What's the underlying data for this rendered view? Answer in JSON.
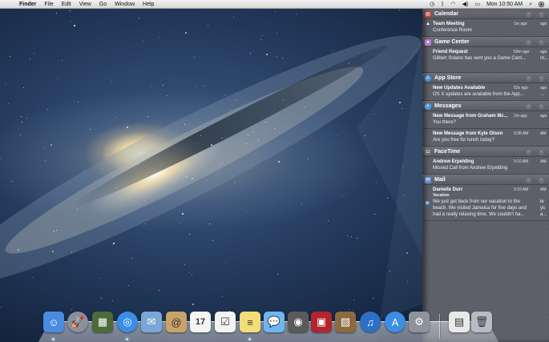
{
  "menubar": {
    "apple_glyph": "",
    "app_name": "Finder",
    "menus": [
      "File",
      "Edit",
      "View",
      "Go",
      "Window",
      "Help"
    ],
    "clock": "Mon 10:50 AM",
    "status_icons": [
      "time-machine-icon",
      "bluetooth-icon",
      "wifi-icon",
      "volume-icon",
      "battery-icon",
      "spotlight-icon"
    ]
  },
  "notification_center": {
    "sections": [
      {
        "app": "Calendar",
        "icon": "calendar-icon",
        "icon_color": "#c33b3b",
        "items": [
          {
            "title": "Team Meeting",
            "time": "1m ago",
            "time_dup": "ago",
            "body": "Conference Room"
          }
        ]
      },
      {
        "app": "Game Center",
        "icon": "game-center-icon",
        "icon_color": "#b47cc8",
        "items": [
          {
            "title": "Friend Request",
            "time": "59m ago",
            "time_dup": "ago",
            "body": "Gilbert Solano has sent you a Game Cent...",
            "body_dup": "nt..."
          }
        ]
      },
      {
        "app": "App Store",
        "icon": "app-store-icon",
        "icon_color": "#3c8fe0",
        "items": [
          {
            "title": "New Updates Available",
            "time": "52s ago",
            "time_dup": "ago",
            "body": "OS X updates are available from the App...",
            "body_dup": "..."
          }
        ]
      },
      {
        "app": "Messages",
        "icon": "messages-icon",
        "icon_color": "#4aa3e8",
        "items": [
          {
            "title": "New Message from Graham Mc...",
            "time": "1m ago",
            "time_dup": "ago",
            "body": "You there?"
          },
          {
            "title": "New Message from Kyle Olson",
            "time": "9:38 AM",
            "time_dup": "AM",
            "body": "Are you free for lunch today?"
          }
        ]
      },
      {
        "app": "FaceTime",
        "icon": "facetime-icon",
        "icon_color": "#6b6b6b",
        "items": [
          {
            "title": "Andrew Erpelding",
            "time": "9:10 AM",
            "time_dup": "AM",
            "body": "Missed Call from Andrew Erpelding"
          }
        ]
      },
      {
        "app": "Mail",
        "icon": "mail-icon",
        "icon_color": "#5a8fd0",
        "items": [
          {
            "title": "Danielle Durr",
            "time": "9:10 AM",
            "time_dup": "AM",
            "subtitle": "Vacation",
            "body": "We just got back from our vacation to the beach.  We visited Jamaica for five days and had a really relaxing time.  We couldn't ha...",
            "body_dup_lines": [
              "le",
              "ys",
              "a..."
            ]
          }
        ]
      }
    ]
  },
  "dock": {
    "items": [
      {
        "name": "Finder",
        "icon": "finder-icon",
        "color": "#4b8be0",
        "glyph": "☺"
      },
      {
        "name": "Launchpad",
        "icon": "launchpad-icon",
        "color": "#8a8f99",
        "glyph": "🚀"
      },
      {
        "name": "Mission Control",
        "icon": "mission-control-icon",
        "color": "#4c6a3a",
        "glyph": "▦"
      },
      {
        "name": "Safari",
        "icon": "safari-icon",
        "color": "#3a8ee6",
        "glyph": "◎"
      },
      {
        "name": "Mail",
        "icon": "mail-stamp-icon",
        "color": "#7aa7d8",
        "glyph": "✉"
      },
      {
        "name": "Contacts",
        "icon": "contacts-icon",
        "color": "#c8a468",
        "glyph": "@"
      },
      {
        "name": "Calendar",
        "icon": "calendar-icon",
        "color": "#f4f4f4",
        "glyph": "17"
      },
      {
        "name": "Reminders",
        "icon": "reminders-icon",
        "color": "#f3f3f3",
        "glyph": "☑"
      },
      {
        "name": "Notes",
        "icon": "notes-icon",
        "color": "#f3dd7a",
        "glyph": "≡"
      },
      {
        "name": "Messages",
        "icon": "messages-icon",
        "color": "#6db7f0",
        "glyph": "💬"
      },
      {
        "name": "FaceTime",
        "icon": "facetime-icon",
        "color": "#5a5a5a",
        "glyph": "◉"
      },
      {
        "name": "Photo Booth",
        "icon": "photo-booth-icon",
        "color": "#b3242c",
        "glyph": "▣"
      },
      {
        "name": "iPhoto",
        "icon": "iphoto-icon",
        "color": "#8c6b3e",
        "glyph": "▧"
      },
      {
        "name": "iTunes",
        "icon": "itunes-icon",
        "color": "#2d6fc7",
        "glyph": "♫"
      },
      {
        "name": "App Store",
        "icon": "app-store-icon",
        "color": "#3a8ee6",
        "glyph": "A"
      },
      {
        "name": "System Preferences",
        "icon": "system-preferences-icon",
        "color": "#8e939c",
        "glyph": "⚙"
      },
      {
        "name": "Documents",
        "icon": "documents-stack-icon",
        "color": "#e9e9e9",
        "glyph": "▤"
      },
      {
        "name": "Trash",
        "icon": "trash-icon",
        "color": "#b8bcc2",
        "glyph": "🗑"
      }
    ]
  }
}
